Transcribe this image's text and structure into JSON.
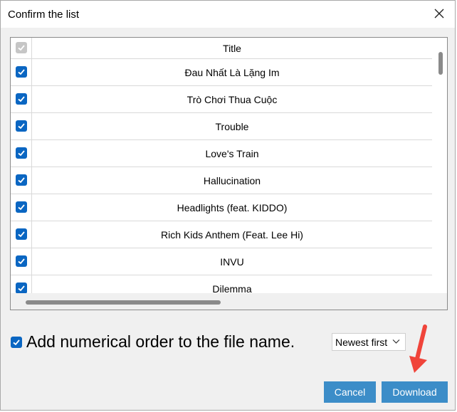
{
  "dialog": {
    "title": "Confirm the list",
    "close_icon": "close-icon"
  },
  "list": {
    "header": {
      "title": "Title",
      "checked": true
    },
    "items": [
      {
        "title": "Đau Nhất Là Lặng Im",
        "checked": true
      },
      {
        "title": "Trò Chơi Thua Cuộc",
        "checked": true
      },
      {
        "title": "Trouble",
        "checked": true
      },
      {
        "title": "Love's Train",
        "checked": true
      },
      {
        "title": "Hallucination",
        "checked": true
      },
      {
        "title": "Headlights (feat. KIDDO)",
        "checked": true
      },
      {
        "title": "Rich Kids Anthem (Feat. Lee Hi)",
        "checked": true
      },
      {
        "title": "INVU",
        "checked": true
      },
      {
        "title": "Dilemma",
        "checked": true
      }
    ]
  },
  "options": {
    "numerical_order_label": "Add numerical order to the file name.",
    "numerical_order_checked": true,
    "sort_selected": "Newest first"
  },
  "buttons": {
    "cancel": "Cancel",
    "download": "Download"
  },
  "colors": {
    "accent": "#0a66c2",
    "button": "#3c8dc8",
    "arrow": "#f0443a"
  }
}
